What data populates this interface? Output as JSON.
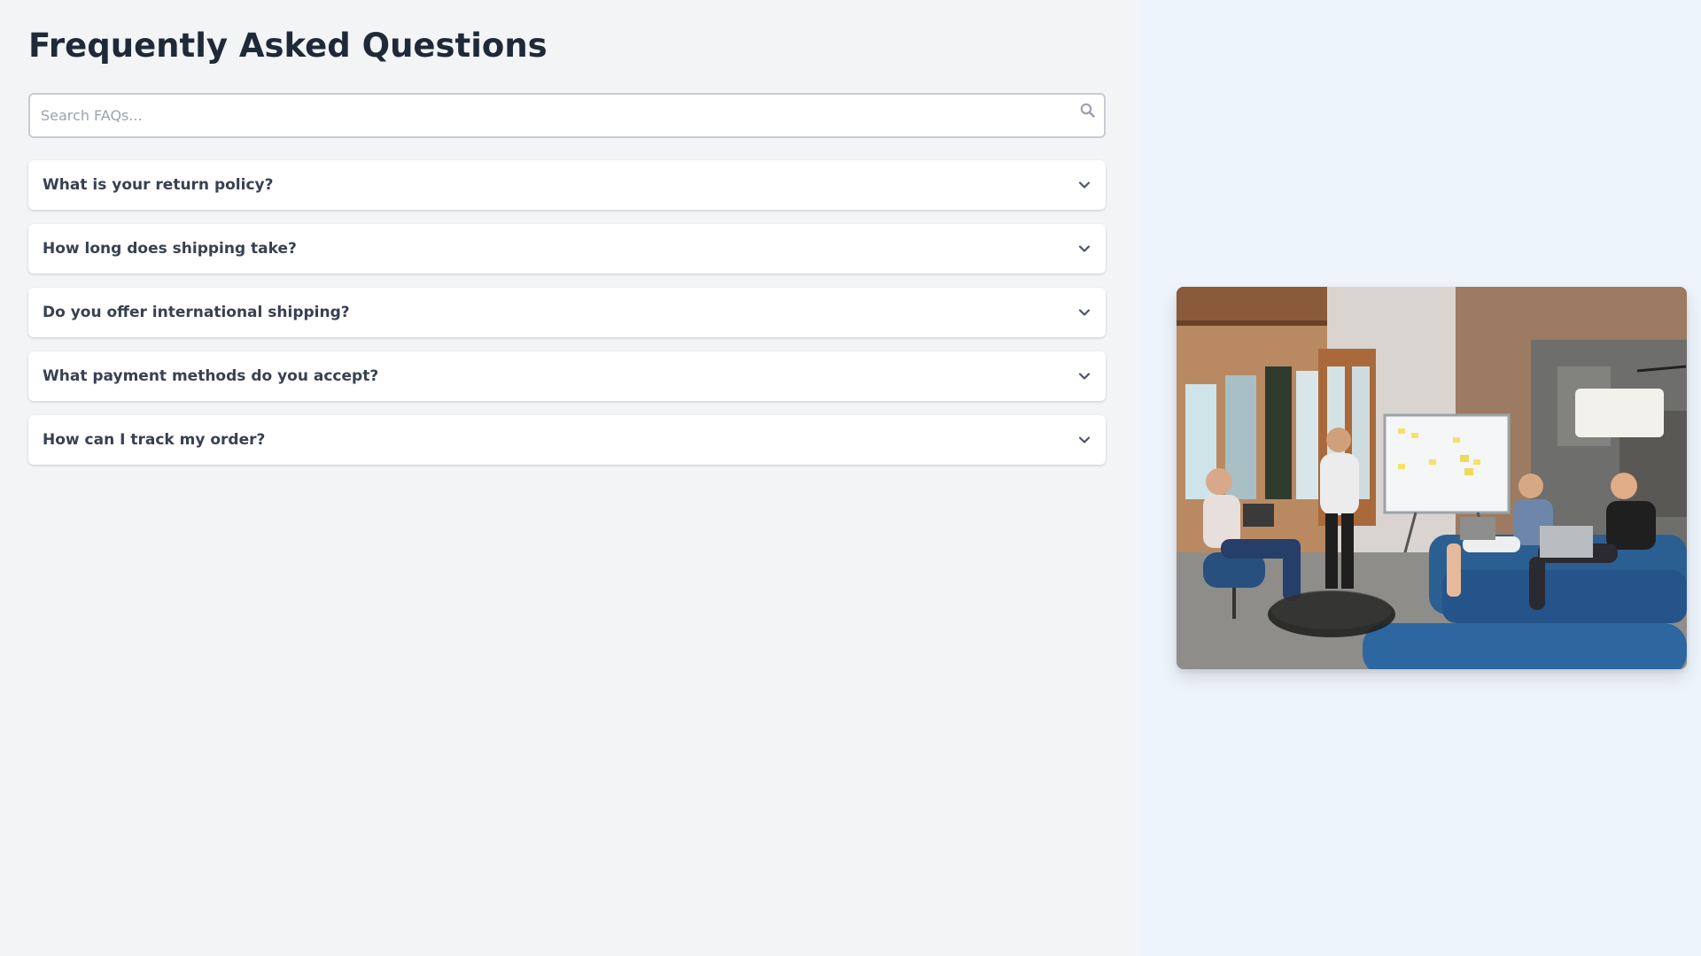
{
  "page": {
    "title": "Frequently Asked Questions"
  },
  "search": {
    "placeholder": "Search FAQs...",
    "value": "",
    "icon": "search-icon"
  },
  "faqs": [
    {
      "question": "What is your return policy?",
      "expanded": false,
      "icon": "chevron-down-icon"
    },
    {
      "question": "How long does shipping take?",
      "expanded": false,
      "icon": "chevron-down-icon"
    },
    {
      "question": "Do you offer international shipping?",
      "expanded": false,
      "icon": "chevron-down-icon"
    },
    {
      "question": "What payment methods do you accept?",
      "expanded": false,
      "icon": "chevron-down-icon"
    },
    {
      "question": "How can I track my order?",
      "expanded": false,
      "icon": "chevron-down-icon"
    }
  ],
  "colors": {
    "title": "#1f2937",
    "question_text": "#374151",
    "main_bg": "#f3f4f6",
    "side_bg": "#eef4fc",
    "card_bg": "#ffffff"
  }
}
